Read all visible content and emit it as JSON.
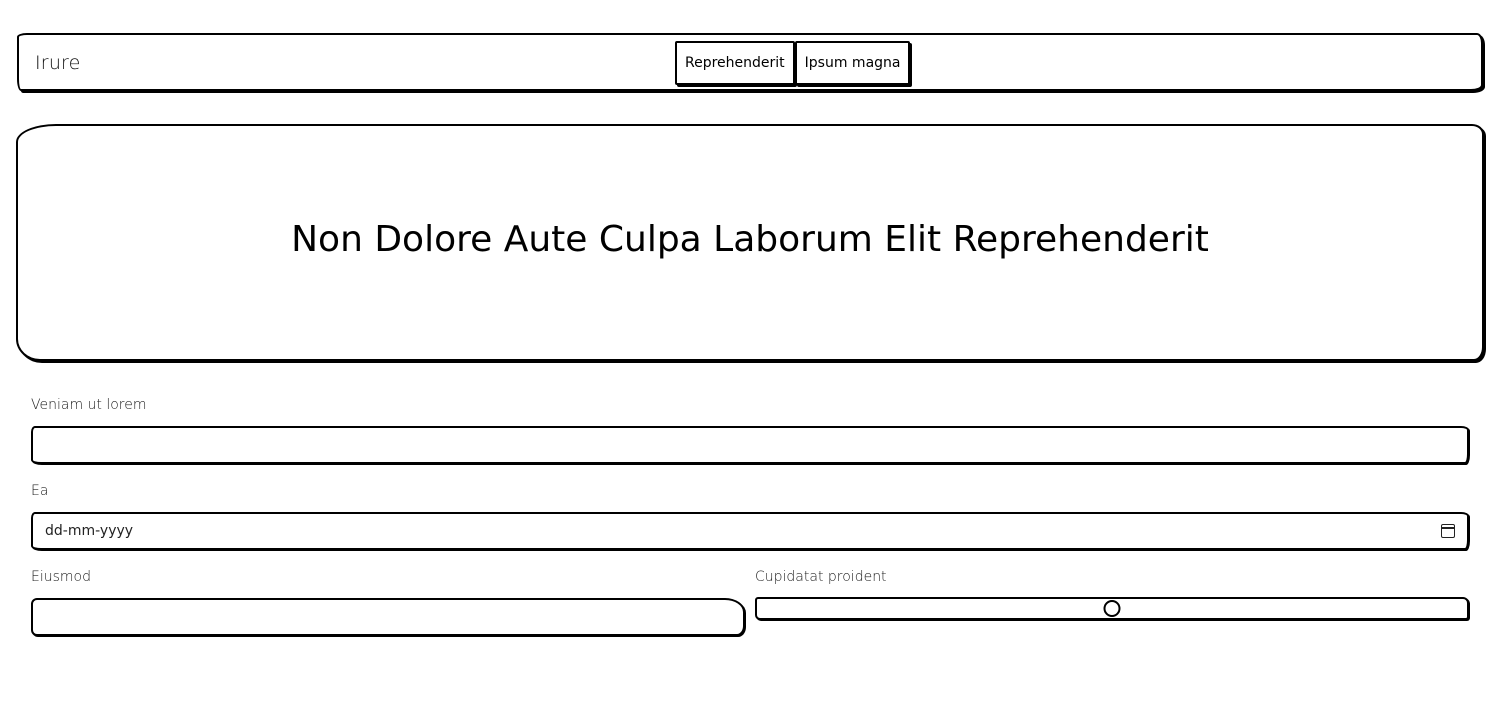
{
  "navbar": {
    "brand": "Irure",
    "buttons": [
      {
        "label": "Reprehenderit"
      },
      {
        "label": "Ipsum magna"
      }
    ]
  },
  "hero": {
    "title": "Non Dolore Aute Culpa Laborum Elit Reprehenderit"
  },
  "form": {
    "field1": {
      "label": "Veniam ut lorem",
      "value": ""
    },
    "field2": {
      "label": "Ea",
      "placeholder": "dd-mm-yyyy",
      "icon": "calendar-icon"
    },
    "field3": {
      "label": "Eiusmod",
      "value": ""
    },
    "field4": {
      "label": "Cupidatat proident",
      "slider_value_fraction": 0.5
    }
  }
}
